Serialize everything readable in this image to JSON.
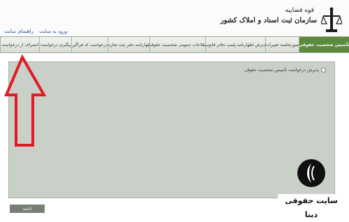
{
  "header": {
    "org_top": "قوه قضاییه",
    "org_main": "سازمان ثبت اسناد و املاک کشور",
    "links": [
      "ورود به سایت",
      "راهنمای سایت"
    ]
  },
  "tabs": [
    "تأسیس شخصیت حقوقی",
    "صورتجلسه تغییرات",
    "پذیرش اظهارنامه پلمپ دفاتر قانونی",
    "اطلاعات عمومی شخصیت حقوقی",
    "اظهارنامه دفتر ثبت تجارتی",
    "درخواست کد فراگیر",
    "پیگیری درخواست",
    "انصراف از درخواست"
  ],
  "panel": {
    "option_label": "پذیرش درخواست تأسیس شخصیت حقوقی"
  },
  "continue_label": "ادامه",
  "watermark": {
    "text": "سایت حقوقی دینا"
  },
  "colors": {
    "active_tab": "#5d8a3e",
    "panel": "#c9d0c7",
    "arrow": "#e01b24"
  }
}
